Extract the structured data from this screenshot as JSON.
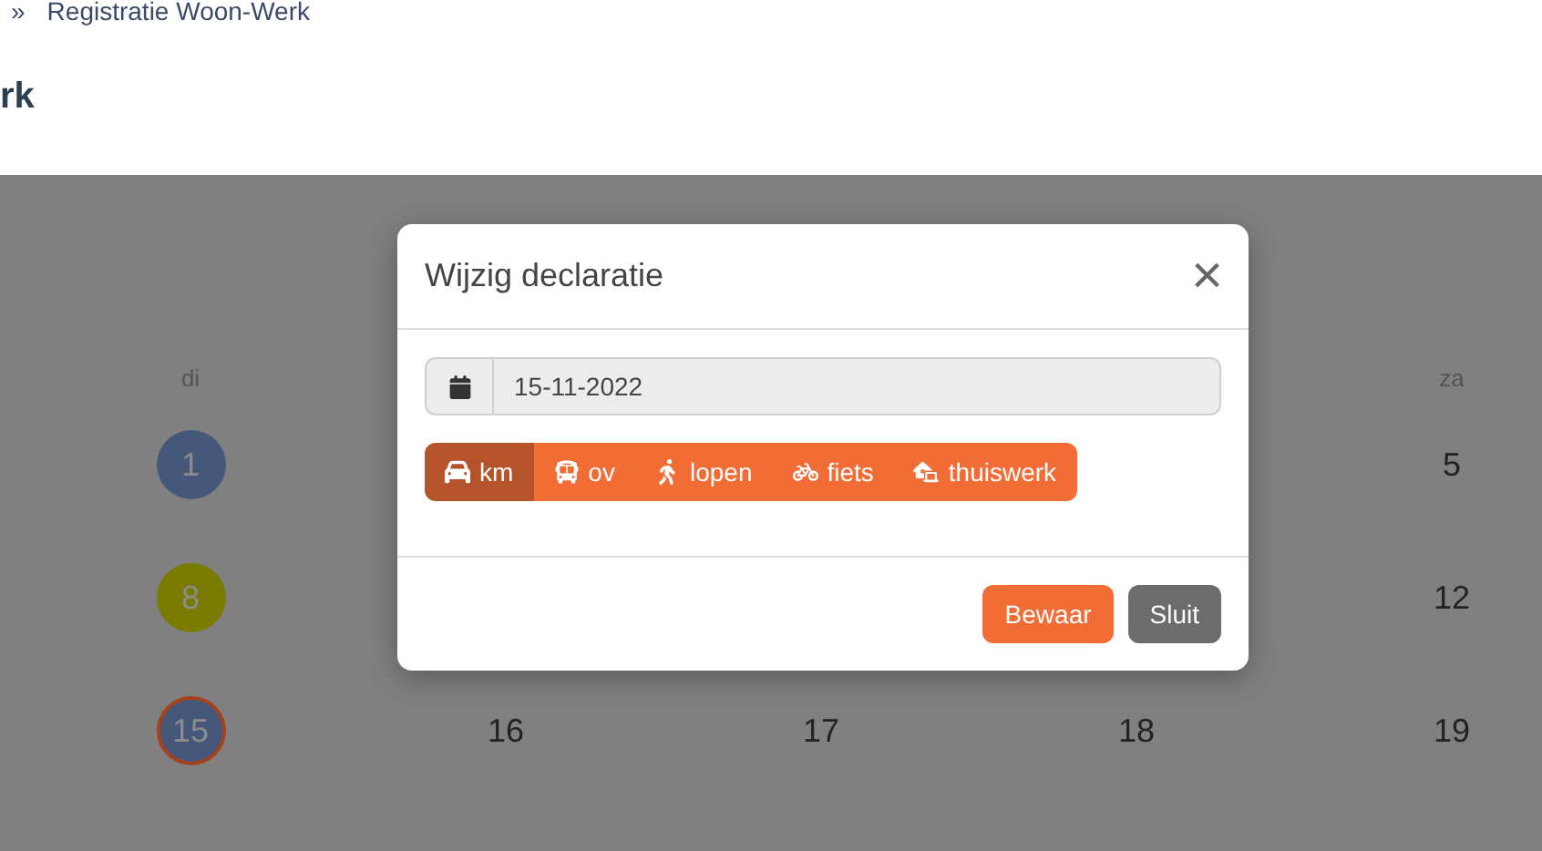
{
  "breadcrumb": {
    "separator": "»",
    "current": "Registratie Woon-Werk"
  },
  "heading": "rk",
  "calendar": {
    "weekdays": {
      "tue": "di",
      "sat": "za"
    },
    "weeks": [
      {
        "tue": {
          "day": "1",
          "color": "#46587a",
          "selected": false
        },
        "sat": {
          "day": "5"
        }
      },
      {
        "tue": {
          "day": "8",
          "color": "#7a7a00",
          "selected": false
        },
        "sat": {
          "day": "12"
        }
      },
      {
        "tue": {
          "day": "15",
          "color": "#46587a",
          "selected": true
        },
        "wed": {
          "day": "16"
        },
        "thu": {
          "day": "17"
        },
        "fri": {
          "day": "18"
        },
        "sat": {
          "day": "19"
        }
      }
    ]
  },
  "dialog": {
    "title": "Wijzig declaratie",
    "close": "×",
    "date": {
      "value": "15-11-2022"
    },
    "modes": [
      {
        "kind": "car",
        "label": "km",
        "selected": true
      },
      {
        "kind": "bus",
        "label": "ov",
        "selected": false
      },
      {
        "kind": "walk",
        "label": "lopen",
        "selected": false
      },
      {
        "kind": "bike",
        "label": "fiets",
        "selected": false
      },
      {
        "kind": "home",
        "label": "thuiswerk",
        "selected": false
      }
    ],
    "buttons": [
      {
        "kind": "primary",
        "label": "Bewaar"
      },
      {
        "kind": "secondary",
        "label": "Sluit"
      }
    ]
  }
}
